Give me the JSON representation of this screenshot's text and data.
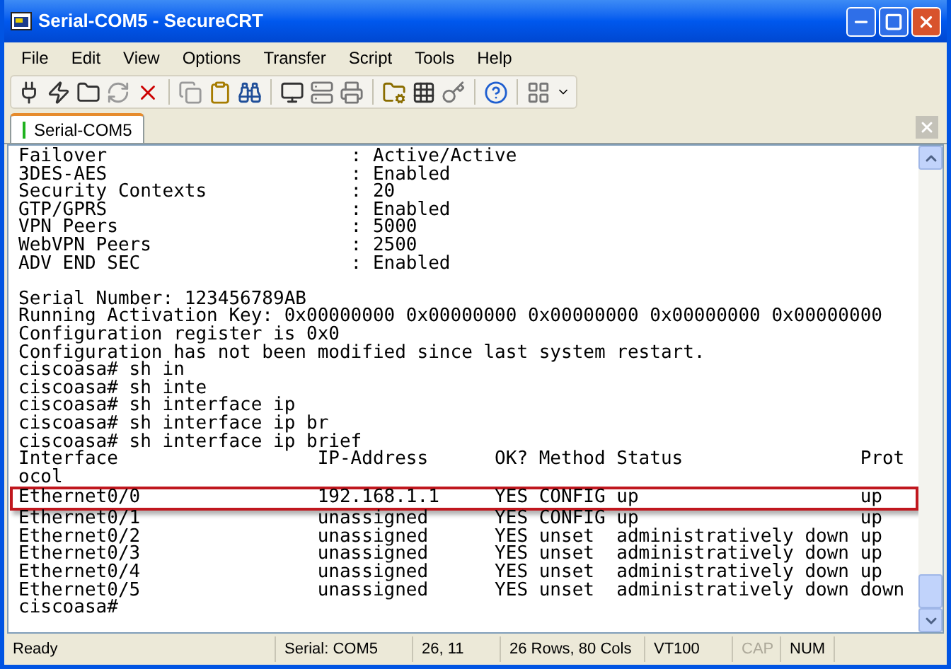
{
  "window": {
    "title": "Serial-COM5 - SecureCRT"
  },
  "menu": [
    "File",
    "Edit",
    "View",
    "Options",
    "Transfer",
    "Script",
    "Tools",
    "Help"
  ],
  "tabs": [
    {
      "label": "Serial-COM5",
      "selected": true
    }
  ],
  "terminal": {
    "lines": [
      {
        "text": "Failover                      : Active/Active",
        "highlighted": false
      },
      {
        "text": "3DES-AES                      : Enabled",
        "highlighted": false
      },
      {
        "text": "Security Contexts             : 20",
        "highlighted": false
      },
      {
        "text": "GTP/GPRS                      : Enabled",
        "highlighted": false
      },
      {
        "text": "VPN Peers                     : 5000",
        "highlighted": false
      },
      {
        "text": "WebVPN Peers                  : 2500",
        "highlighted": false
      },
      {
        "text": "ADV END SEC                   : Enabled",
        "highlighted": false
      },
      {
        "highlighted": false
      },
      {
        "text": "Serial Number: 123456789AB",
        "highlighted": false
      },
      {
        "text": "Running Activation Key: 0x00000000 0x00000000 0x00000000 0x00000000 0x00000000",
        "highlighted": false
      },
      {
        "text": "Configuration register is 0x0",
        "highlighted": false
      },
      {
        "text": "Configuration has not been modified since last system restart.",
        "highlighted": false
      },
      {
        "text": "ciscoasa# sh in",
        "highlighted": false
      },
      {
        "text": "ciscoasa# sh inte",
        "highlighted": false
      },
      {
        "text": "ciscoasa# sh interface ip",
        "highlighted": false
      },
      {
        "text": "ciscoasa# sh interface ip br",
        "highlighted": false
      },
      {
        "text": "ciscoasa# sh interface ip brief",
        "highlighted": false
      },
      {
        "text": "Interface                  IP-Address      OK? Method Status                Prot",
        "highlighted": false
      },
      {
        "text": "ocol",
        "highlighted": false
      },
      {
        "text": "Ethernet0/0                192.168.1.1     YES CONFIG up                    up",
        "highlighted": true
      },
      {
        "text": "Ethernet0/1                unassigned      YES CONFIG up                    up",
        "highlighted": false
      },
      {
        "text": "Ethernet0/2                unassigned      YES unset  administratively down up",
        "highlighted": false
      },
      {
        "text": "Ethernet0/3                unassigned      YES unset  administratively down up",
        "highlighted": false
      },
      {
        "text": "Ethernet0/4                unassigned      YES unset  administratively down up",
        "highlighted": false
      },
      {
        "text": "Ethernet0/5                unassigned      YES unset  administratively down down",
        "highlighted": false
      },
      {
        "text": "ciscoasa#",
        "highlighted": false
      }
    ]
  },
  "status_bar": [
    {
      "text": "Ready",
      "enabled": true
    },
    {
      "text": "Serial: COM5",
      "enabled": true
    },
    {
      "text": "26, 11",
      "enabled": true
    },
    {
      "text": "26 Rows, 80 Cols",
      "enabled": true
    },
    {
      "text": "VT100",
      "enabled": true
    },
    {
      "text": "CAP",
      "enabled": false
    },
    {
      "text": "NUM",
      "enabled": true
    }
  ]
}
